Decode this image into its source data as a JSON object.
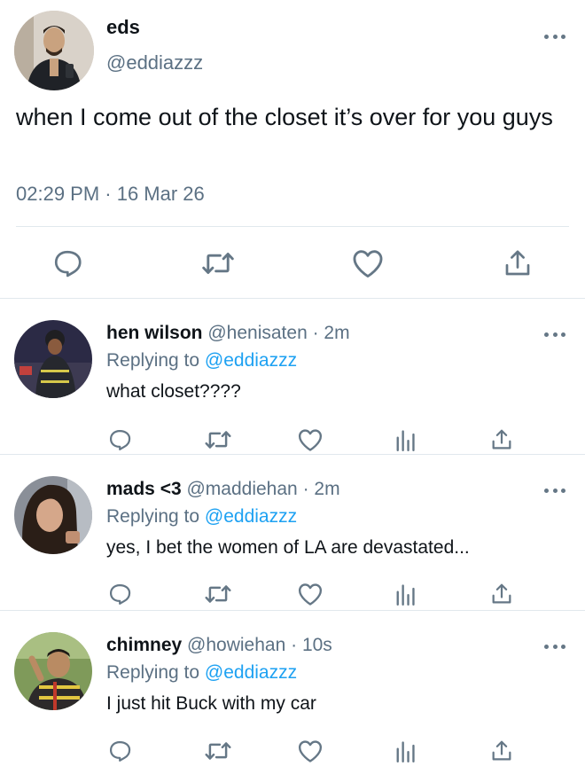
{
  "main_tweet": {
    "avatar_icon": "user-avatar-eds",
    "name": "eds",
    "handle": "@eddiazzz",
    "text": "when I come out of the closet it’s over for you guys",
    "timestamp": "02:29 PM · 16 Mar 26",
    "actions": [
      "reply-icon",
      "retweet-icon",
      "like-icon",
      "share-icon"
    ]
  },
  "replies": [
    {
      "name": "hen wilson",
      "handle": "@henisaten",
      "time": "· 2m",
      "replying_label": "Replying to",
      "replying_to": "@eddiazzz",
      "text": "what closet????"
    },
    {
      "name": "mads <3",
      "handle": "@maddiehan",
      "time": "· 2m",
      "replying_label": "Replying to",
      "replying_to": "@eddiazzz",
      "text": "yes, I bet the women of LA are devastated..."
    },
    {
      "name": "chimney",
      "handle": "@howiehan",
      "time": "· 10s",
      "replying_label": "Replying to",
      "replying_to": "@eddiazzz",
      "text": "I just hit Buck with my car"
    }
  ],
  "reply_actions": [
    "reply-icon",
    "retweet-icon",
    "like-icon",
    "analytics-icon",
    "share-icon"
  ],
  "colors": {
    "link": "#1da1f2",
    "secondary_text": "#5b7083",
    "icon": "#657786",
    "divider": "#e1e8ed"
  }
}
